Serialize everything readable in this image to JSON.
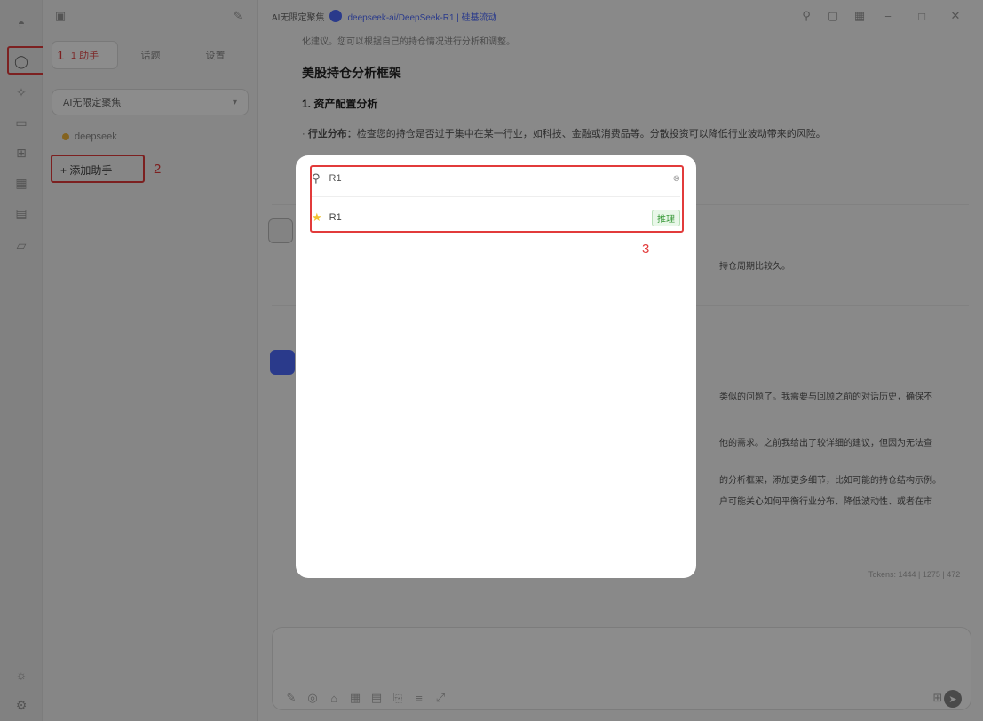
{
  "sidebar": {
    "tabs": [
      "1 助手",
      "话题",
      "设置"
    ],
    "group_dropdown": "AI无限定聚焦",
    "assistant_name": "deepseek",
    "add_assistant_label": "+ 添加助手"
  },
  "annotations": [
    "1",
    "2",
    "3"
  ],
  "header": {
    "group": "AI无限定聚焦",
    "model": "deepseek-ai/DeepSeek-R1 | 硅基流动"
  },
  "chat": {
    "intro_line": "化建议。您可以根据自己的持仓情况进行分析和调整。",
    "heading": "美股持仓分析框架",
    "subheading": "1. 资产配置分析",
    "bullet_bold": "行业分布：",
    "bullet_text": "检查您的持仓是否过于集中在某一行业，如科技、金融或消费品等。分散投资可以降低行业波动带来的风险。",
    "fragment_1": "持仓周期比较久。",
    "fragment_2": "类似的问题了。我需要与回顾之前的对话历史，确保不",
    "fragment_3": "他的需求。之前我给出了较详细的建议，但因为无法查",
    "fragment_4": "的分析框架，添加更多细节，比如可能的持仓结构示例。",
    "fragment_5": "户可能关心如何平衡行业分布、降低波动性、或者在市",
    "tokens": "Tokens: 1444 | 1275 | 472"
  },
  "modal": {
    "search_value": "R1",
    "result_label": "R1",
    "result_badge": "推理"
  }
}
